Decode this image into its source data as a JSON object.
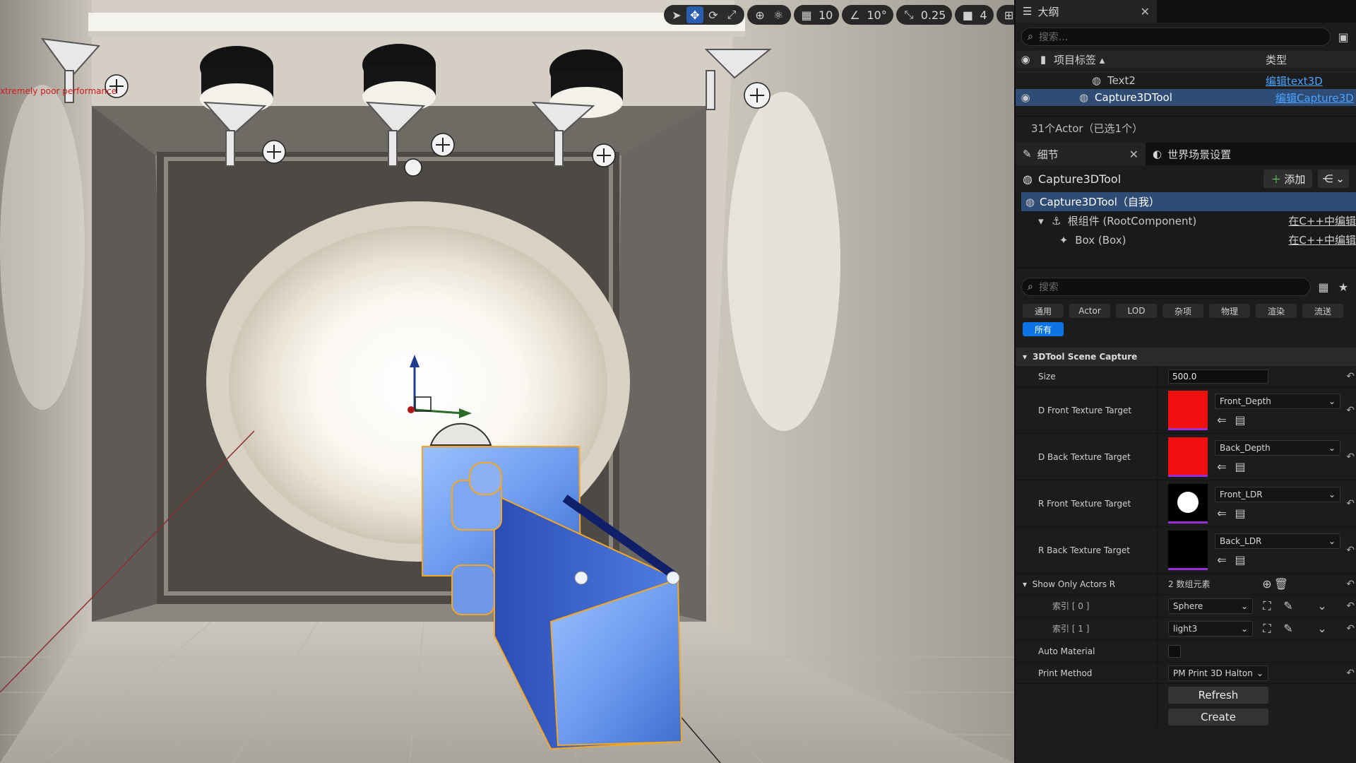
{
  "viewport": {
    "perf_warning": "xtremely poor performance",
    "toolbar": {
      "grid_snap": "10",
      "rotation_snap": "10°",
      "scale_snap": "0.25",
      "camera_speed": "4"
    }
  },
  "outliner": {
    "tab_label": "大纲",
    "search_placeholder": "搜索...",
    "col_label": "项目标签",
    "col_type": "类型",
    "rows": [
      {
        "name": "Text2",
        "type": "编辑text3D"
      },
      {
        "name": "Capture3DTool",
        "type": "编辑Capture3D"
      }
    ],
    "status": "31个Actor（已选1个）"
  },
  "details": {
    "tab_label": "细节",
    "world_tab_label": "世界场景设置",
    "actor_name": "Capture3DTool",
    "add_label": "添加",
    "components": [
      {
        "label": "Capture3DTool（自我）",
        "right": ""
      },
      {
        "label": "根组件 (RootComponent)",
        "right": "在C++中编辑"
      },
      {
        "label": "Box (Box)",
        "right": "在C++中编辑"
      }
    ],
    "search_placeholder": "搜索",
    "filter_tabs": [
      "通用",
      "Actor",
      "LOD",
      "杂项",
      "物理",
      "渲染",
      "流送",
      "所有"
    ],
    "section_title": "3DTool Scene Capture",
    "size_label": "Size",
    "size_value": "500.0",
    "texture_targets": [
      {
        "label": "D Front Texture Target",
        "asset": "Front_Depth",
        "thumb_color": "#f01010"
      },
      {
        "label": "D Back Texture Target",
        "asset": "Back_Depth",
        "thumb_color": "#f01010"
      },
      {
        "label": "R Front Texture Target",
        "asset": "Front_LDR",
        "thumb_color": "#000000"
      },
      {
        "label": "R Back Texture Target",
        "asset": "Back_LDR",
        "thumb_color": "#000000"
      }
    ],
    "show_only_label": "Show Only Actors R",
    "show_only_count": "2 数组元素",
    "array_items": [
      {
        "index_label": "索引 [ 0 ]",
        "value": "Sphere"
      },
      {
        "index_label": "索引 [ 1 ]",
        "value": "light3"
      }
    ],
    "auto_material_label": "Auto Material",
    "print_method_label": "Print Method",
    "print_method_value": "PM Print 3D Halton",
    "refresh_label": "Refresh",
    "create_label": "Create"
  },
  "colors": {
    "accent": "#0d74e6",
    "selection": "#2f4c74",
    "link": "#4aa3ff",
    "warning": "#d11a1a",
    "mesh_blue": "#6f9df0",
    "mesh_outline": "#f5a623"
  }
}
